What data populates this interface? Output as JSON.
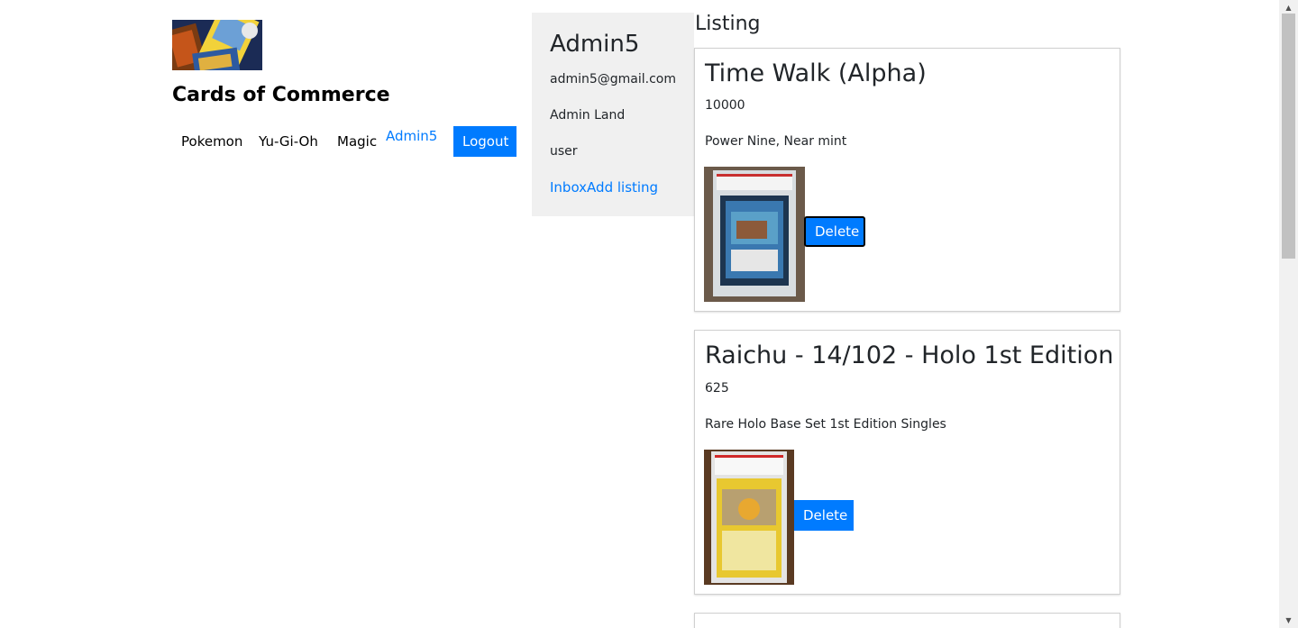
{
  "header": {
    "logo_alt": "trading cards logo",
    "site_title": "Cards of Commerce"
  },
  "nav": {
    "items": [
      {
        "label": "Pokemon"
      },
      {
        "label": "Yu-Gi-Oh"
      },
      {
        "label": "Magic"
      }
    ],
    "user_link": "Admin5",
    "logout_label": "Logout"
  },
  "profile": {
    "name": "Admin5",
    "email": "admin5@gmail.com",
    "location": "Admin Land",
    "role": "user",
    "inbox_link": "Inbox",
    "add_listing_link": "Add listing"
  },
  "listing": {
    "heading": "Listing",
    "items": [
      {
        "title": "Time Walk (Alpha)",
        "price": "10000",
        "description": "Power Nine, Near mint",
        "delete_label": "Delete"
      },
      {
        "title": "Raichu - 14/102 - Holo 1st Edition",
        "price": "625",
        "description": "Rare Holo Base Set 1st Edition Singles",
        "delete_label": "Delete"
      }
    ]
  },
  "colors": {
    "primary": "#007bff",
    "panel_bg": "#f0f0f0",
    "text": "#212529"
  }
}
